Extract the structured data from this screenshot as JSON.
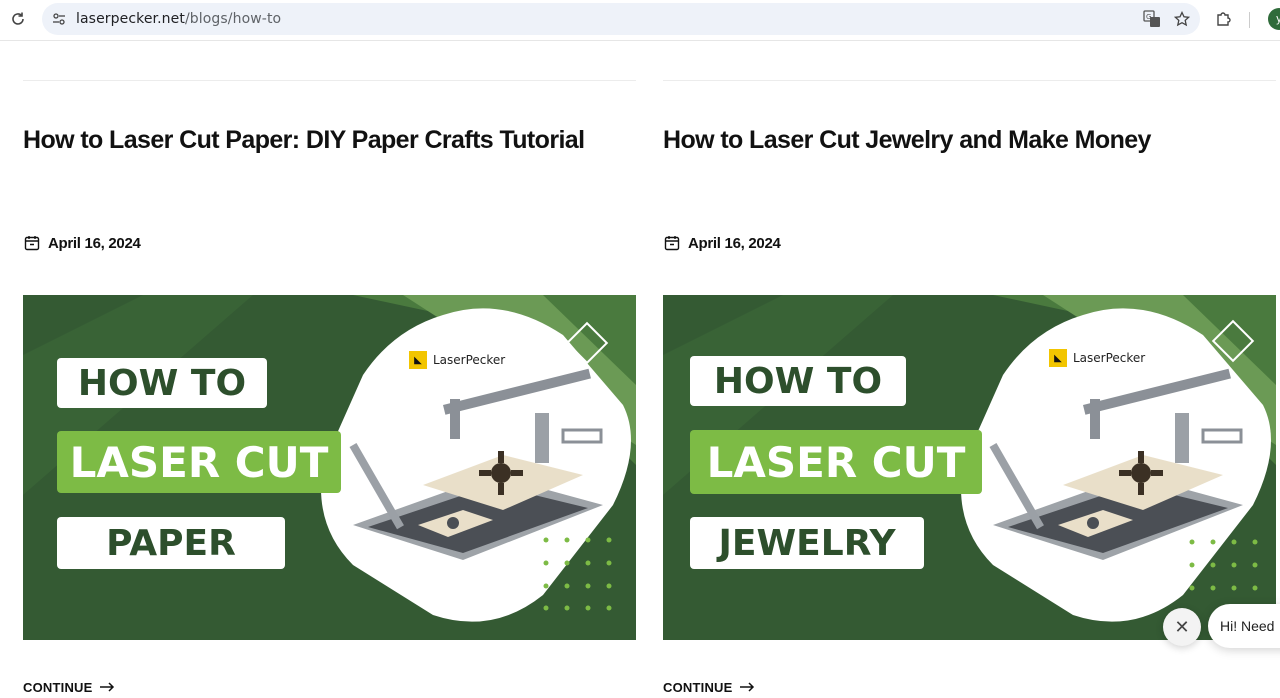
{
  "browser": {
    "url_domain": "laserpecker.net",
    "url_path": "/blogs/how-to",
    "avatar_letter": "y"
  },
  "posts": [
    {
      "title": "How to Laser Cut Paper: DIY Paper Crafts Tutorial",
      "date": "April 16, 2024",
      "thumb_line1": "HOW TO",
      "thumb_line2": "LASER CUT",
      "thumb_line3": "PAPER",
      "brand": "LaserPecker",
      "continue": "CONTINUE"
    },
    {
      "title": "How to Laser Cut Jewelry and Make Money",
      "date": "April 16, 2024",
      "thumb_line1": "HOW TO",
      "thumb_line2": "LASER CUT",
      "thumb_line3": "JEWELRY",
      "brand": "LaserPecker",
      "continue": "CONTINUE"
    }
  ],
  "chat": {
    "bubble_text": "Hi! Need"
  },
  "colors": {
    "thumb_dark_green": "#345a33",
    "thumb_light_green": "#7dbb45"
  }
}
